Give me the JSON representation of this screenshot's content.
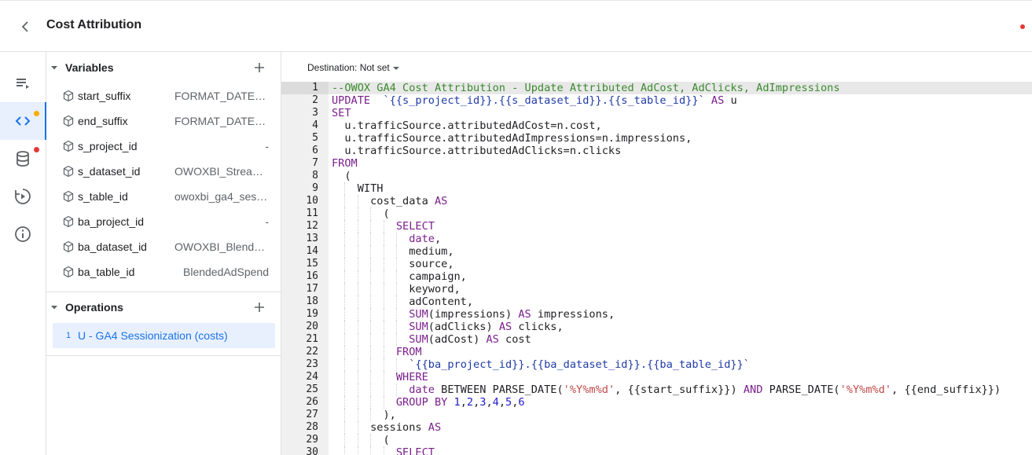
{
  "header": {
    "title": "Cost Attribution"
  },
  "rail": {
    "items": [
      {
        "name": "queue-list-icon",
        "active": false,
        "badge": null
      },
      {
        "name": "code-icon",
        "active": true,
        "badge": "#f9ab00"
      },
      {
        "name": "database-icon",
        "active": false,
        "badge": "#e53935"
      },
      {
        "name": "play-history-icon",
        "active": false,
        "badge": null
      },
      {
        "name": "info-icon",
        "active": false,
        "badge": null
      }
    ]
  },
  "variables": {
    "label": "Variables",
    "items": [
      {
        "name": "start_suffix",
        "value": "FORMAT_DATE('…"
      },
      {
        "name": "end_suffix",
        "value": "FORMAT_DATE('…"
      },
      {
        "name": "s_project_id",
        "value": "-"
      },
      {
        "name": "s_dataset_id",
        "value": "OWOXBI_Streami…"
      },
      {
        "name": "s_table_id",
        "value": "owoxbi_ga4_sess…"
      },
      {
        "name": "ba_project_id",
        "value": "-"
      },
      {
        "name": "ba_dataset_id",
        "value": "OWOXBI_Blended…"
      },
      {
        "name": "ba_table_id",
        "value": "BlendedAdSpend"
      }
    ]
  },
  "operations": {
    "label": "Operations",
    "items": [
      {
        "number": "1",
        "name": "U - GA4 Sessionization (costs)"
      }
    ]
  },
  "destination": {
    "label": "Destination: Not set"
  },
  "editor": {
    "lines": [
      [
        [
          "cm",
          "--OWOX GA4 Cost Attribution - Update Attributed AdCost, AdClicks, AdImpressions"
        ]
      ],
      [
        [
          "kw",
          "UPDATE"
        ],
        [
          "",
          "  "
        ],
        [
          "tp",
          "`{{s_project_id}}.{{s_dataset_id}}.{{s_table_id}}`"
        ],
        [
          "",
          ""
        ],
        [
          "kw",
          " AS"
        ],
        [
          "",
          " u"
        ]
      ],
      [
        [
          "kw",
          "SET"
        ]
      ],
      [
        [
          "",
          "  u.trafficSource.attributedAdCost=n.cost,"
        ]
      ],
      [
        [
          "",
          "  u.trafficSource.attributedAdImpressions=n.impressions,"
        ]
      ],
      [
        [
          "",
          "  u.trafficSource.attributedAdClicks=n.clicks"
        ]
      ],
      [
        [
          "kw",
          "FROM"
        ]
      ],
      [
        [
          "",
          "  ("
        ]
      ],
      [
        [
          "",
          "    WITH"
        ]
      ],
      [
        [
          "",
          "      cost_data "
        ],
        [
          "kw",
          "AS"
        ]
      ],
      [
        [
          "",
          "        ("
        ]
      ],
      [
        [
          "",
          "          "
        ],
        [
          "kw",
          "SELECT"
        ]
      ],
      [
        [
          "",
          "            "
        ],
        [
          "kw",
          "date"
        ],
        [
          "",
          ","
        ]
      ],
      [
        [
          "",
          "            medium,"
        ]
      ],
      [
        [
          "",
          "            source,"
        ]
      ],
      [
        [
          "",
          "            campaign,"
        ]
      ],
      [
        [
          "",
          "            keyword,"
        ]
      ],
      [
        [
          "",
          "            adContent,"
        ]
      ],
      [
        [
          "",
          "            "
        ],
        [
          "kw",
          "SUM"
        ],
        [
          "",
          "(impressions) "
        ],
        [
          "kw",
          "AS"
        ],
        [
          "",
          " impressions,"
        ]
      ],
      [
        [
          "",
          "            "
        ],
        [
          "kw",
          "SUM"
        ],
        [
          "",
          "(adClicks) "
        ],
        [
          "kw",
          "AS"
        ],
        [
          "",
          " clicks,"
        ]
      ],
      [
        [
          "",
          "            "
        ],
        [
          "kw",
          "SUM"
        ],
        [
          "",
          "(adCost) "
        ],
        [
          "kw",
          "AS"
        ],
        [
          "",
          " cost"
        ]
      ],
      [
        [
          "",
          "          "
        ],
        [
          "kw",
          "FROM"
        ]
      ],
      [
        [
          "",
          "            "
        ],
        [
          "tp",
          "`{{ba_project_id}}.{{ba_dataset_id}}.{{ba_table_id}}`"
        ]
      ],
      [
        [
          "",
          "          "
        ],
        [
          "kw",
          "WHERE"
        ]
      ],
      [
        [
          "",
          "            "
        ],
        [
          "kw",
          "date"
        ],
        [
          "",
          " BETWEEN PARSE_DATE("
        ],
        [
          "st",
          "'%Y%m%d'"
        ],
        [
          "",
          ", {{start_suffix}}) "
        ],
        [
          "kw",
          "AND"
        ],
        [
          "",
          " PARSE_DATE("
        ],
        [
          "st",
          "'%Y%m%d'"
        ],
        [
          "",
          ", {{end_suffix}})"
        ]
      ],
      [
        [
          "",
          "          "
        ],
        [
          "kw",
          "GROUP BY"
        ],
        [
          "",
          " "
        ],
        [
          "nm",
          "1"
        ],
        [
          "",
          ","
        ],
        [
          "nm",
          "2"
        ],
        [
          "",
          ","
        ],
        [
          "nm",
          "3"
        ],
        [
          "",
          ","
        ],
        [
          "nm",
          "4"
        ],
        [
          "",
          ","
        ],
        [
          "nm",
          "5"
        ],
        [
          "",
          ","
        ],
        [
          "nm",
          "6"
        ]
      ],
      [
        [
          "",
          "        ),"
        ]
      ],
      [
        [
          "",
          "      sessions "
        ],
        [
          "kw",
          "AS"
        ]
      ],
      [
        [
          "",
          "        ("
        ]
      ],
      [
        [
          "",
          "          "
        ],
        [
          "kw",
          "SELECT"
        ]
      ]
    ]
  }
}
